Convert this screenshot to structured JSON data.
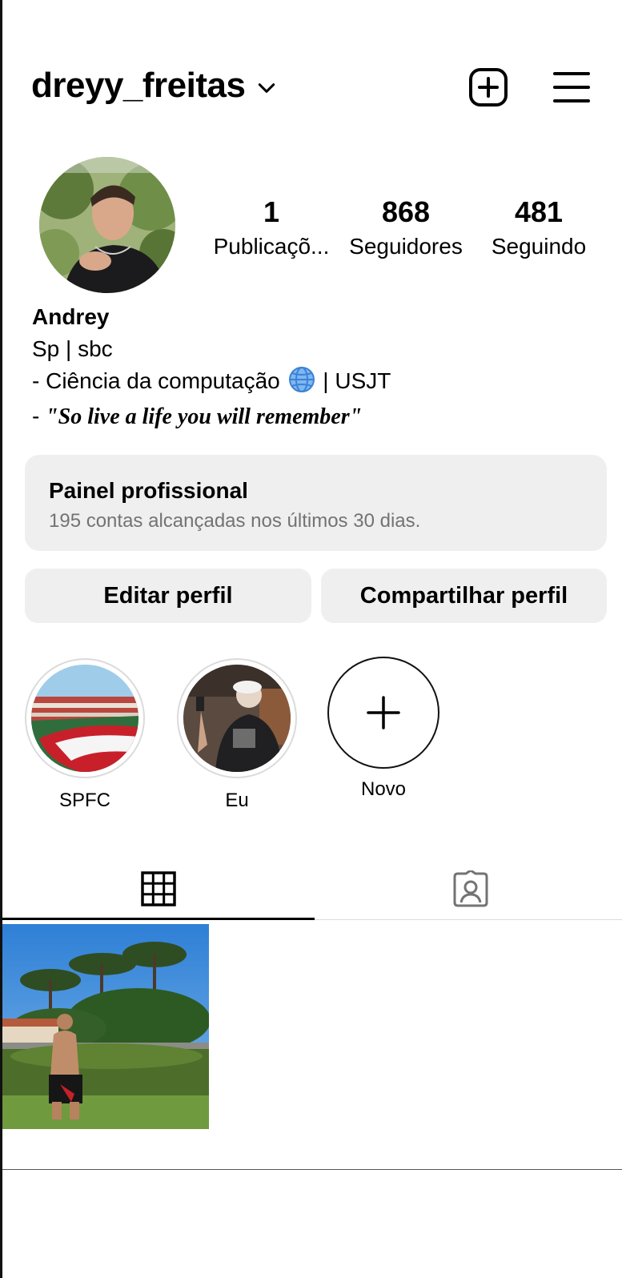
{
  "header": {
    "username": "dreyy_freitas",
    "icons": [
      "chevron-down-icon",
      "new-post-icon",
      "menu-icon"
    ]
  },
  "stats": {
    "posts": {
      "value": "1",
      "label": "Publicaçõ..."
    },
    "followers": {
      "value": "868",
      "label": "Seguidores"
    },
    "following": {
      "value": "481",
      "label": "Seguindo"
    }
  },
  "bio": {
    "name": "Andrey",
    "line1": "Sp | sbc",
    "line2_before": "- Ciência da computação ",
    "line2_after": " | USJT",
    "line3_prefix": "-  ",
    "line3_quote": "\"So live a life you will remember\""
  },
  "dashboard": {
    "title": "Painel profissional",
    "subtitle": "195 contas alcançadas nos últimos 30 dias."
  },
  "buttons": {
    "edit": "Editar perfil",
    "share": "Compartilhar perfil"
  },
  "highlights": [
    {
      "label": "SPFC"
    },
    {
      "label": "Eu"
    },
    {
      "label": "Novo"
    }
  ],
  "tabs": [
    "grid-icon",
    "tagged-icon"
  ],
  "colors": {
    "button_bg": "#efefef",
    "subtle_text": "#737373",
    "divider": "#dbdbdb"
  }
}
